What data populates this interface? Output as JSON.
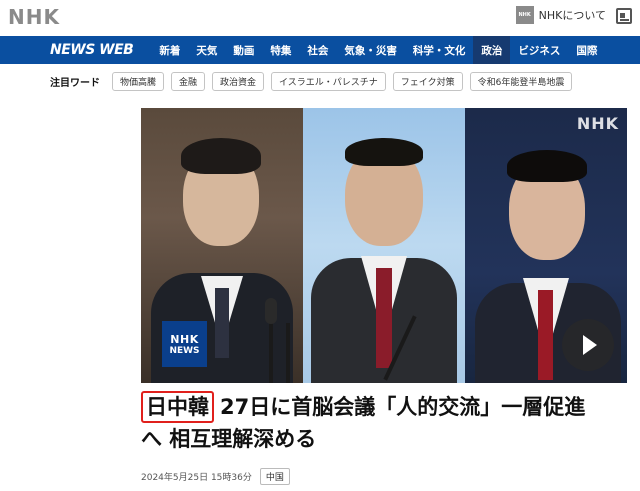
{
  "header": {
    "logo": "NHK",
    "about_badge": "NHK",
    "about_label": "NHKについて"
  },
  "nav": {
    "brand": "NEWS WEB",
    "items": [
      "新着",
      "天気",
      "動画",
      "特集",
      "社会",
      "気象・災害",
      "科学・文化",
      "政治",
      "ビジネス",
      "国際"
    ],
    "active": "政治"
  },
  "trending": {
    "label": "注目ワード",
    "chips": [
      "物価高騰",
      "金融",
      "政治資金",
      "イスラエル・パレスチナ",
      "フェイク対策",
      "令和6年能登半島地震"
    ]
  },
  "hero": {
    "watermark": "NHK",
    "badge_top": "NHK",
    "badge_bottom": "NEWS"
  },
  "article": {
    "headline_highlight": "日中韓",
    "headline_line1": "27日に首脳会議「人的交流」一層促進",
    "headline_line2": "へ 相互理解深める",
    "date": "2024年5月25日 15時36分",
    "tag": "中国"
  },
  "colors": {
    "nav_bg": "#0a4fa0",
    "nav_active": "#163a70",
    "highlight_border": "#e0201c"
  }
}
